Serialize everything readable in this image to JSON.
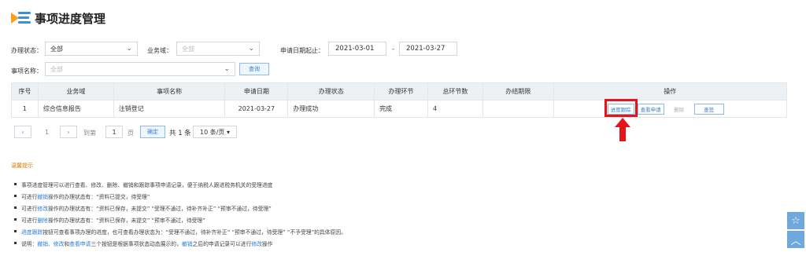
{
  "header": {
    "title": "事项进度管理"
  },
  "filters": {
    "status_label": "办理状态：",
    "status_value": "全部",
    "domain_label": "业务域：",
    "domain_value": "全部",
    "date_label": "申请日期起止：",
    "date_from": "2021-03-01",
    "date_sep": "-",
    "date_to": "2021-03-27",
    "item_label": "事项名称：",
    "item_value": "全部",
    "query_button": "查询"
  },
  "table": {
    "headers": [
      "序号",
      "业务域",
      "事项名称",
      "申请日期",
      "办理状态",
      "办理环节",
      "总环节数",
      "办结期限",
      "操作"
    ],
    "rows": [
      {
        "no": "1",
        "domain": "综合信息报告",
        "name": "注销登记",
        "date": "2021-03-27",
        "status": "办理成功",
        "step": "完成",
        "total": "4",
        "deadline": ""
      }
    ],
    "ops": {
      "progress": "进度跟踪",
      "view": "查看申请",
      "delete": "删除",
      "query": "查签"
    }
  },
  "pager": {
    "prev": "‹",
    "page": "1",
    "next": "›",
    "goto_label": "到第",
    "goto_value": "1",
    "page_unit": "页",
    "confirm": "确定",
    "total": "共 1 条",
    "page_size": "10 条/页 ▾"
  },
  "notice": {
    "title": "温馨提示",
    "lines": [
      [
        "事项进度管理可以进行查看、修改、删除、撤销和跟踪事项申请记录，便于纳税人跟进税务机关的受理进度"
      ],
      [
        "可进行",
        "撤销",
        "操作的办理状态有：“资料已提交，待受理”"
      ],
      [
        "可进行",
        "修改",
        "操作的办理状态有：“资料已保存，未提交”  “受理不通过，待补齐补正”  “预审不通过，待受理”"
      ],
      [
        "可进行",
        "删除",
        "操作的办理状态有：“资料已保存，未提交”  “预审不通过，待受理”"
      ],
      [
        "",
        "进度跟踪",
        "按钮可查看事项办理的进度，也可查看办理状态为：“受理不通过，待补齐补正”  “预审不通过，待受理”  “不予受理”的具体原因。"
      ],
      [
        "说明：",
        "撤销、修改",
        "和",
        "查看申请",
        "三个按钮是根据事项状态动态展示的，",
        "撤销",
        "之后的申请记录可以进行",
        "修改",
        "操作"
      ]
    ]
  },
  "side": {
    "star": "☆",
    "top": "︿"
  },
  "colors": {
    "accent": "#3a7fcb",
    "highlight": "#e5141b",
    "notice": "#e07b00"
  }
}
